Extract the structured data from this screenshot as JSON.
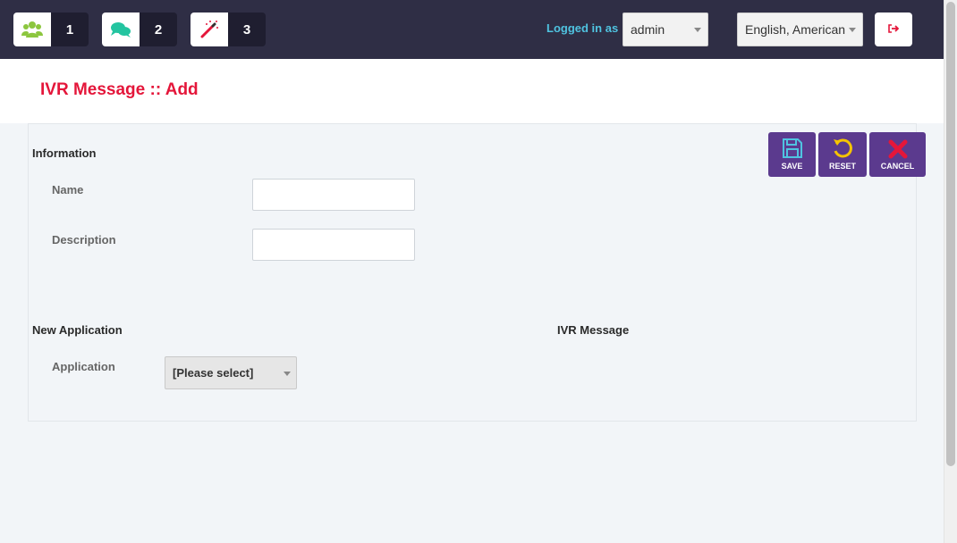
{
  "topbar": {
    "badges": [
      {
        "icon": "users-icon",
        "count": "1"
      },
      {
        "icon": "chat-icon",
        "count": "2"
      },
      {
        "icon": "magic-wand-icon",
        "count": "3"
      }
    ],
    "logged_in_label": "Logged in as :",
    "user_select_value": "admin",
    "language_select_value": "English, American",
    "logout_icon": "logout-icon"
  },
  "page": {
    "title": "IVR Message :: Add"
  },
  "actions": {
    "save_label": "SAVE",
    "reset_label": "RESET",
    "cancel_label": "CANCEL"
  },
  "form": {
    "information_heading": "Information",
    "name_label": "Name",
    "name_value": "",
    "description_label": "Description",
    "description_value": "",
    "new_application_heading": "New Application",
    "application_label": "Application",
    "application_select_value": "[Please select]",
    "ivr_message_heading": "IVR Message"
  },
  "colors": {
    "topbar_bg": "#2f2e45",
    "title_red": "#e4163a",
    "button_purple": "#5b3a8e",
    "logged_in_cyan": "#4fc3e0"
  }
}
